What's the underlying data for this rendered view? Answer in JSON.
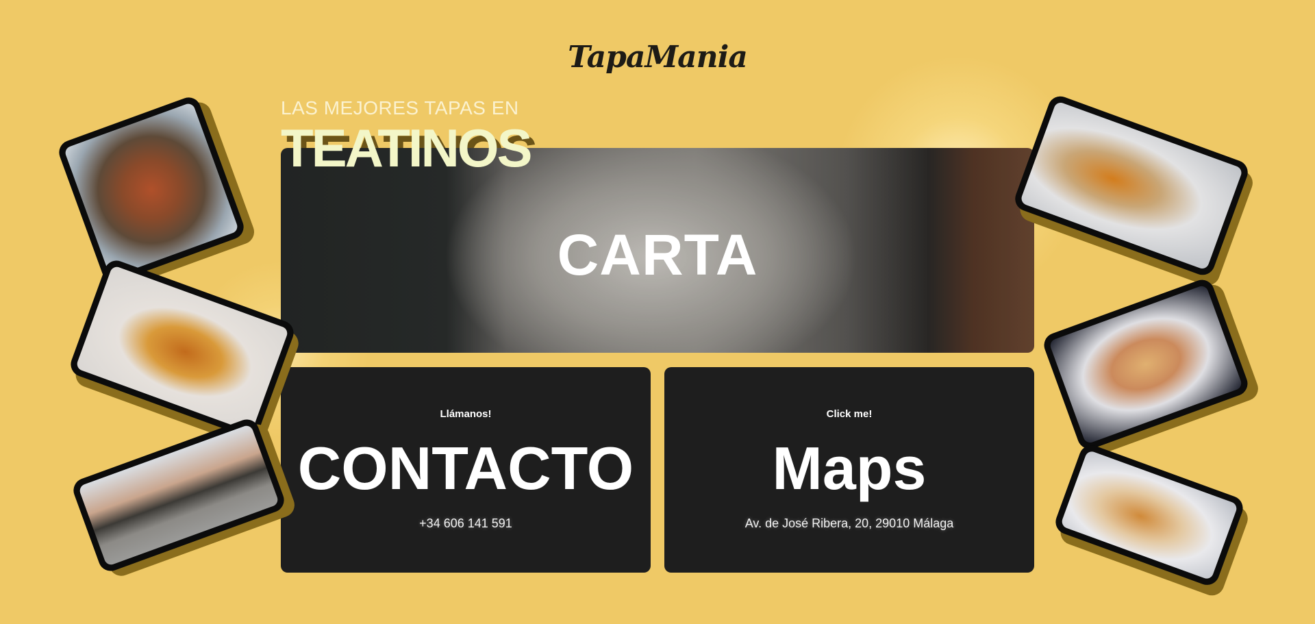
{
  "brand": {
    "logo": "TapaMania"
  },
  "hero": {
    "tagline": "LAS MEJORES TAPAS EN",
    "headline": "TEATINOS"
  },
  "carta": {
    "title": "CARTA"
  },
  "contact": {
    "kicker": "Llámanos!",
    "title": "CONTACTO",
    "phone": "+34 606 141 591"
  },
  "maps": {
    "kicker": "Click me!",
    "title": "Maps",
    "address": "Av. de José Ribera, 20, 29010 Málaga"
  },
  "colors": {
    "background": "#efc966",
    "card": "#1e1e1e",
    "headline": "#f3f6c8",
    "headline_shadow": "#6b5418",
    "frame_shadow": "#8a6d1c"
  }
}
